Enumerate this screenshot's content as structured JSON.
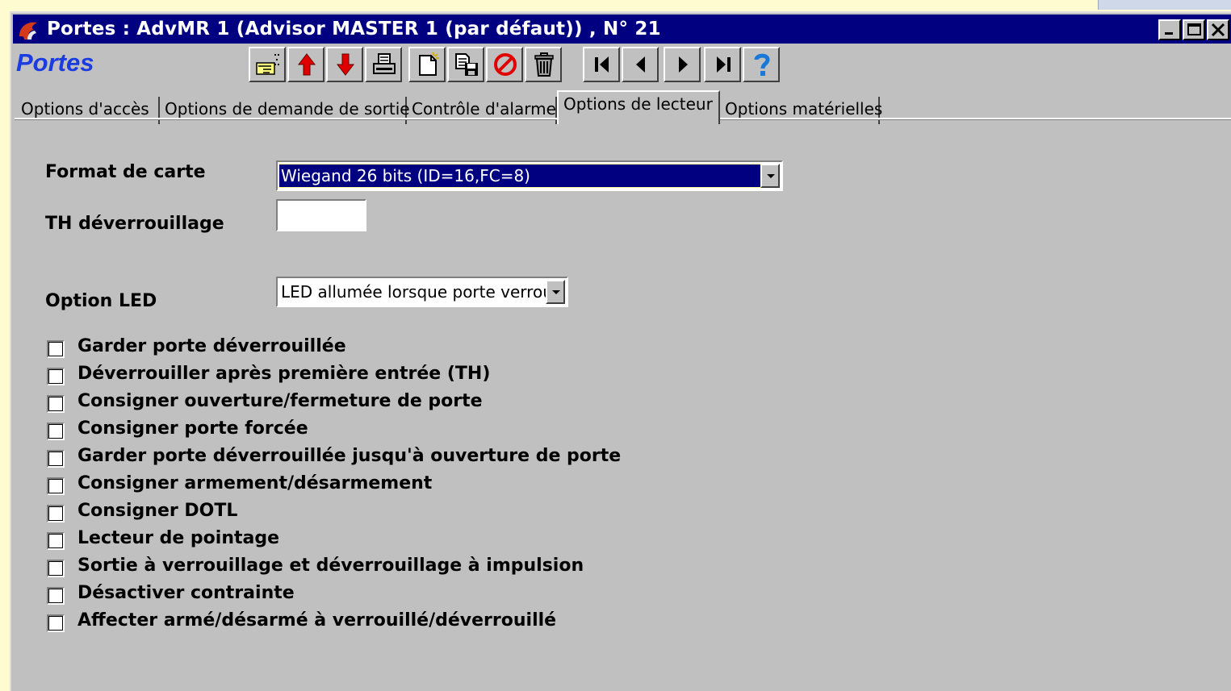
{
  "window": {
    "title": "Portes : AdvMR 1 (Advisor MASTER 1 (par défaut)) , N° 21",
    "controls": [
      "minimize-icon",
      "maximize-icon",
      "close-icon"
    ]
  },
  "module_title": "Portes",
  "toolbar": {
    "tools": [
      {
        "icon": "pointing-hand-icon"
      },
      {
        "icon": "arrow-up-icon"
      },
      {
        "icon": "arrow-down-icon"
      },
      {
        "icon": "printer-icon"
      },
      {
        "icon": "new-document-icon"
      },
      {
        "icon": "copy-save-icon"
      },
      {
        "icon": "cancel-icon"
      },
      {
        "icon": "trash-icon"
      },
      {
        "icon": "first-record-icon"
      },
      {
        "icon": "previous-record-icon"
      },
      {
        "icon": "next-record-icon"
      },
      {
        "icon": "last-record-icon"
      },
      {
        "icon": "help-icon"
      }
    ]
  },
  "tabs": [
    {
      "label": "Options d'accès"
    },
    {
      "label": "Options de demande de sortie"
    },
    {
      "label": "Contrôle d'alarme"
    },
    {
      "label": "Options de lecteur",
      "active": true
    },
    {
      "label": "Options matérielles"
    }
  ],
  "form": {
    "card_format_label": "Format de carte",
    "card_format_value": "Wiegand 26 bits (ID=16,FC=8)",
    "unlock_th_label": "TH déverrouillage",
    "unlock_th_value": "",
    "led_option_label": "Option LED",
    "led_option_value": "LED allumée lorsque porte verrouil"
  },
  "checkboxes": [
    {
      "label": "Garder porte déverrouillée",
      "checked": false
    },
    {
      "label": "Déverrouiller après première entrée (TH)",
      "checked": false
    },
    {
      "label": "Consigner ouverture/fermeture de porte",
      "checked": false
    },
    {
      "label": "Consigner porte forcée",
      "checked": false
    },
    {
      "label": "Garder porte déverrouillée jusqu'à ouverture de porte",
      "checked": false
    },
    {
      "label": "Consigner armement/désarmement",
      "checked": false
    },
    {
      "label": "Consigner DOTL",
      "checked": false
    },
    {
      "label": "Lecteur de pointage",
      "checked": false
    },
    {
      "label": "Sortie à verrouillage et déverrouillage à impulsion",
      "checked": false
    },
    {
      "label": "Désactiver contrainte",
      "checked": false
    },
    {
      "label": "Affecter armé/désarmé à verrouillé/déverrouillé",
      "checked": false
    }
  ],
  "colors": {
    "titlebar": "#000080",
    "module_title": "#1a3ce0",
    "face": "#c0c0c0"
  }
}
